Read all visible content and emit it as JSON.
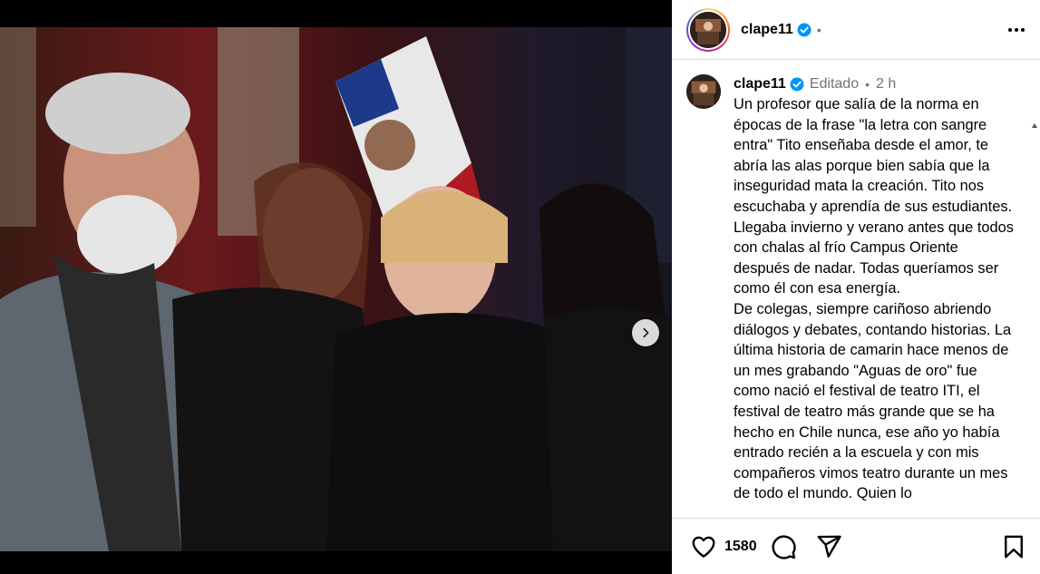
{
  "post": {
    "username": "clape11",
    "verified": true,
    "header_dot": "•",
    "more_icon": "more-horizontal-icon",
    "caption": {
      "username": "clape11",
      "edited_label": "Editado",
      "separator": "•",
      "time": "2 h",
      "text": "Un profesor que salía de la norma en épocas de la frase \"la letra con sangre entra\" Tito enseñaba desde el amor, te abría las alas porque bien sabía que la inseguridad mata la creación. Tito nos escuchaba y aprendía de sus estudiantes. Llegaba invierno y verano antes que todos con chalas al frío Campus Oriente después de nadar. Todas queríamos ser como él con esa energía.\nDe colegas, siempre cariñoso abriendo diálogos y debates, contando historias. La última historia de camarin hace menos de un mes grabando \"Aguas de oro\" fue como nació el festival de teatro ITI, el festival de teatro más grande que se ha hecho en Chile nunca, ese año yo había entrado recién a la escuela y con mis compañeros vimos teatro durante un mes de todo el mundo. Quien lo"
    },
    "likes_count": "1580",
    "colors": {
      "verified_blue": "#0095f6",
      "text": "#000000",
      "secondary_text": "#737373",
      "border": "#dbdbdb"
    }
  }
}
